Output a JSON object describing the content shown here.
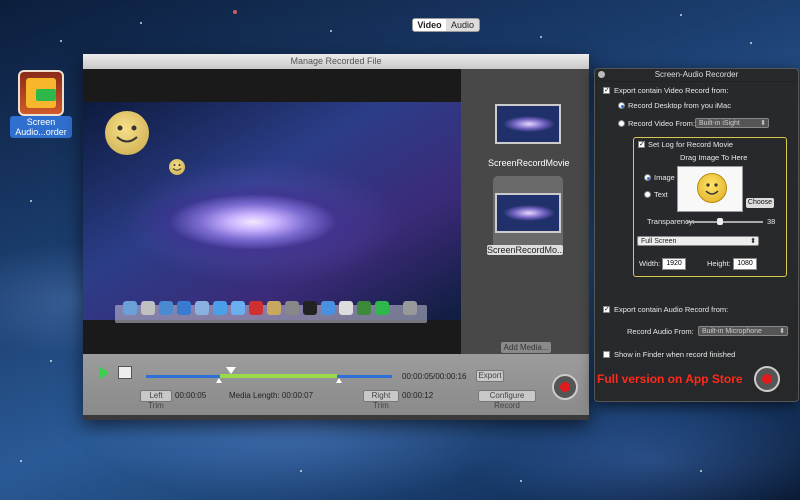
{
  "desktop": {
    "icon_label": "Screen Audio...order"
  },
  "main_window": {
    "title": "Manage Recorded File",
    "tabs": [
      "Video",
      "Audio"
    ],
    "active_tab": "Video",
    "media": [
      {
        "label": "ScreenRecordMovie"
      },
      {
        "label": "ScreenRecordMo..."
      }
    ],
    "add_media_label": "Add Media...",
    "transport": {
      "time_position": "00:00:05/00:00:16",
      "export_label": "Export",
      "left_trim_label": "Left Trim",
      "left_trim_time": "00:00:05",
      "media_length": "Media Length: 00:00:07",
      "right_trim_label": "Right Trim",
      "right_trim_time": "00:00:12",
      "configure_label": "Configure Record"
    }
  },
  "recorder": {
    "title": "Screen-Audio Recorder",
    "export_video_label": "Export contain Video Record from:",
    "record_desktop_label": "Record Desktop from you iMac",
    "record_video_label": "Record Video From:",
    "video_source": "Built-in iSight",
    "set_log_label": "Set Log for Record Movie",
    "drag_image_label": "Drag Image To Here",
    "image_label": "Image",
    "text_label": "Text",
    "choose_label": "Choose",
    "transparency_label": "Transparency:",
    "transparency_value": "38",
    "size_mode": "Full Screen",
    "width_label": "Width:",
    "width_value": "1920",
    "height_label": "Height:",
    "height_value": "1080",
    "export_audio_label": "Export contain Audio Record from:",
    "record_audio_label": "Record Audio From:",
    "audio_source": "Built-in Microphone",
    "show_finder_label": "Show in Finder when record finished",
    "appstore_label": "Full version on App Store"
  }
}
